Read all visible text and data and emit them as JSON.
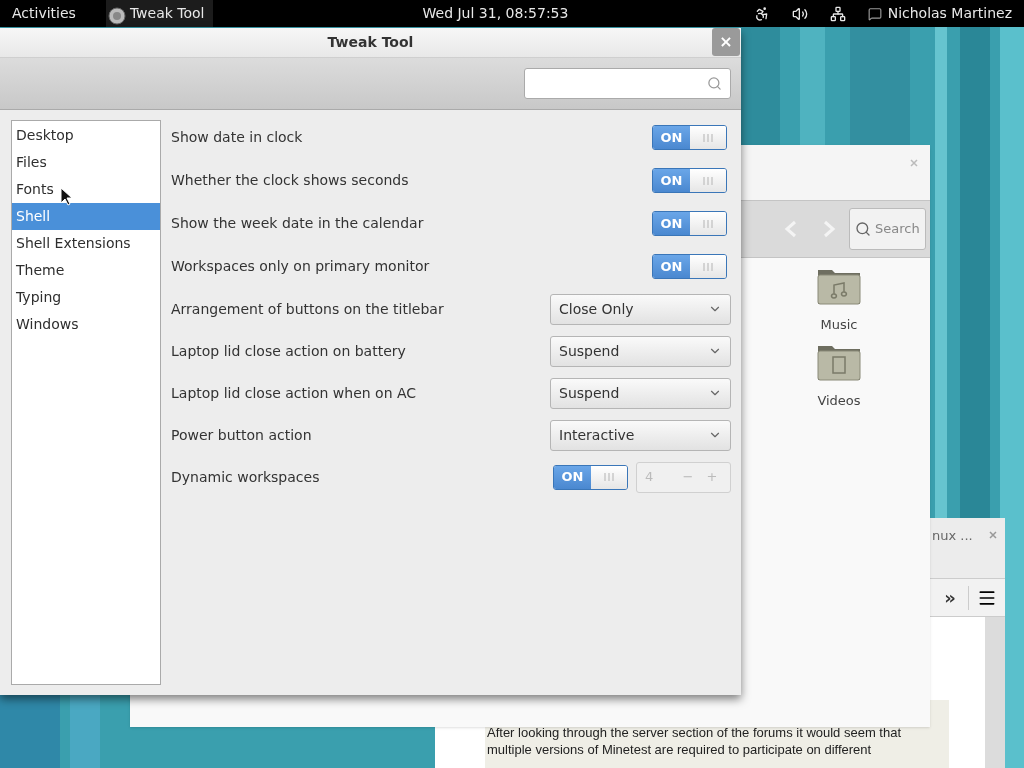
{
  "top_bar": {
    "activities": "Activities",
    "app_name": "Tweak Tool",
    "clock": "Wed Jul 31, 08:57:53",
    "user": "Nicholas Martinez"
  },
  "browser_window": {
    "title": "nux ...",
    "toolbar": {
      "more": "»"
    },
    "text": "After looking through the server section of the forums it would seem that multiple versions of Minetest are required to participate on different"
  },
  "files_window": {
    "search": {
      "placeholder": "Search"
    },
    "items": [
      {
        "label": "Music",
        "kind": "music"
      },
      {
        "label": "Videos",
        "kind": "video"
      }
    ]
  },
  "tweak_window": {
    "title": "Tweak Tool",
    "close": "×",
    "sidebar": {
      "items": [
        {
          "label": "Desktop",
          "selected": false
        },
        {
          "label": "Files",
          "selected": false
        },
        {
          "label": "Fonts",
          "selected": false
        },
        {
          "label": "Shell",
          "selected": true
        },
        {
          "label": "Shell Extensions",
          "selected": false
        },
        {
          "label": "Theme",
          "selected": false
        },
        {
          "label": "Typing",
          "selected": false
        },
        {
          "label": "Windows",
          "selected": false
        }
      ]
    },
    "settings": [
      {
        "kind": "switch",
        "label": "Show date in clock",
        "on": true,
        "state_label": "ON"
      },
      {
        "kind": "switch",
        "label": "Whether the clock shows seconds",
        "on": true,
        "state_label": "ON"
      },
      {
        "kind": "switch",
        "label": "Show the week date in the calendar",
        "on": true,
        "state_label": "ON"
      },
      {
        "kind": "switch",
        "label": "Workspaces only on primary monitor",
        "on": true,
        "state_label": "ON"
      },
      {
        "kind": "dropdown",
        "label": "Arrangement of buttons on the titlebar",
        "value": "Close Only"
      },
      {
        "kind": "dropdown",
        "label": "Laptop lid close action on battery",
        "value": "Suspend"
      },
      {
        "kind": "dropdown",
        "label": "Laptop lid close action when on AC",
        "value": "Suspend"
      },
      {
        "kind": "dropdown",
        "label": "Power button action",
        "value": "Interactive"
      },
      {
        "kind": "switch_spin",
        "label": "Dynamic workspaces",
        "on": true,
        "state_label": "ON",
        "spin": {
          "value": "4",
          "disabled": true,
          "minus": "−",
          "plus": "+"
        }
      }
    ]
  }
}
